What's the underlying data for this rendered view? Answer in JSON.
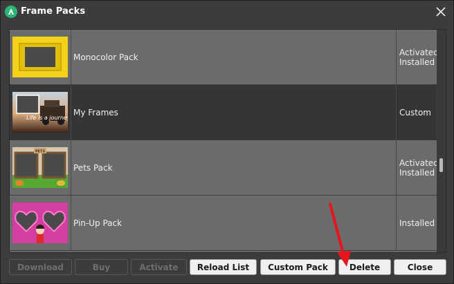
{
  "window": {
    "title": "Frame Packs"
  },
  "packs": [
    {
      "name": "Monocolor Pack",
      "status": [
        "Activated",
        "Installed"
      ],
      "selected": false
    },
    {
      "name": "My Frames",
      "status": [
        "Custom"
      ],
      "selected": true
    },
    {
      "name": "Pets Pack",
      "status": [
        "Activated",
        "Installed"
      ],
      "selected": false
    },
    {
      "name": "Pin-Up Pack",
      "status": [
        "Installed"
      ],
      "selected": false
    }
  ],
  "thumbnails": {
    "0": {
      "text": ""
    },
    "1": {
      "text": "Life is a journey"
    },
    "2": {
      "text": "PETS"
    }
  },
  "buttons": {
    "download": "Download",
    "buy": "Buy",
    "activate": "Activate",
    "reload": "Reload List",
    "custom": "Custom Pack",
    "delete": "Delete",
    "close": "Close"
  },
  "colors": {
    "accent_annotation": "#e8141b",
    "selected_row": "#353535",
    "row": "#6b6b6b"
  }
}
